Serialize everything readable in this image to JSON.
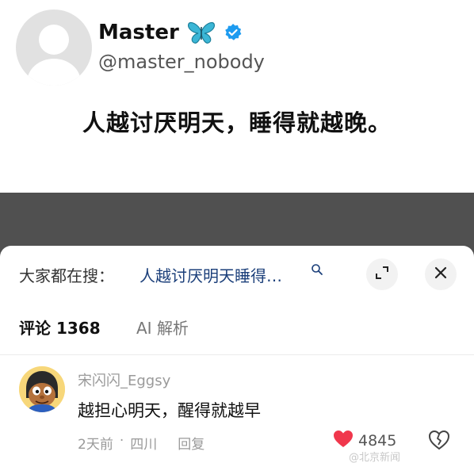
{
  "tweet": {
    "display_name": "Master",
    "handle": "@master_nobody",
    "text": "人越讨厌明天，睡得就越晚。",
    "icons": [
      "default-avatar-icon",
      "butterfly-icon",
      "verified-badge-icon"
    ],
    "colors": {
      "verified": "#1d9bf0",
      "butterfly": "#3bb6d6"
    }
  },
  "sheet": {
    "search": {
      "prefix": "大家都在搜：",
      "query": "人越讨厌明天睡得…",
      "icons": [
        "search-icon",
        "expand-icon",
        "close-icon"
      ]
    },
    "tabs": [
      {
        "label": "评论 1368",
        "active": true
      },
      {
        "label": "AI 解析",
        "active": false
      }
    ],
    "comment": {
      "username": "宋闪闪_Eggsy",
      "text": "越担心明天，醒得就越早",
      "time": "2天前",
      "separator": "·",
      "location": "四川",
      "reply_label": "回复",
      "like_count": "4845",
      "icons": [
        "user-avatar",
        "heart-icon",
        "dislike-icon"
      ],
      "colors": {
        "heart": "#f0374c"
      }
    }
  },
  "watermark": "@北京新闻"
}
